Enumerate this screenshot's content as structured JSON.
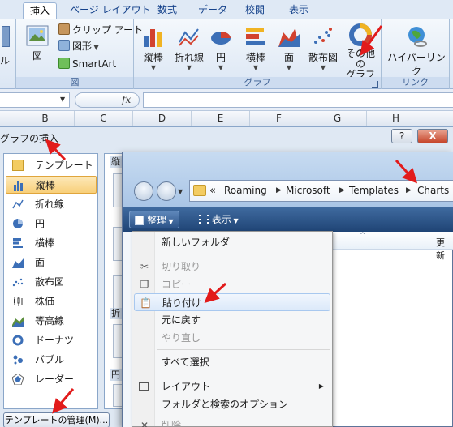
{
  "ribbon": {
    "tabs": [
      "挿入",
      "ページ レイアウト",
      "数式",
      "データ",
      "校閲",
      "表示"
    ],
    "active_tab": "挿入",
    "left_cut_label": "ル",
    "illustrations": {
      "group_label": "図",
      "picture": "図",
      "clip_art": "クリップ アート",
      "shapes": "図形",
      "smartart": "SmartArt"
    },
    "charts": {
      "group_label": "グラフ",
      "buttons": [
        "縦棒",
        "折れ線",
        "円",
        "横棒",
        "面",
        "散布図"
      ],
      "other_charts_line1": "その他の",
      "other_charts_line2": "グラフ"
    },
    "links": {
      "group_label": "リンク",
      "hyperlink": "ハイパーリンク"
    }
  },
  "formula_bar": {
    "fx": "fx"
  },
  "columns": [
    "B",
    "C",
    "D",
    "E",
    "F",
    "G",
    "H"
  ],
  "chart_dialog": {
    "title": "グラフの挿入",
    "help_button": "?",
    "close_button": "X",
    "chart_types": [
      "テンプレート",
      "縦棒",
      "折れ線",
      "円",
      "横棒",
      "面",
      "散布図",
      "株価",
      "等高線",
      "ドーナツ",
      "バブル",
      "レーダー"
    ],
    "selected_type": "縦棒",
    "subtype_headers": [
      "縦",
      "折",
      "円"
    ],
    "manage_templates_button": "テンプレートの管理(M)..."
  },
  "explorer": {
    "breadcrumb": [
      "Roaming",
      "Microsoft",
      "Templates",
      "Charts"
    ],
    "breadcrumb_prefix": "«",
    "toolbar": {
      "organize": "整理",
      "views": "表示"
    },
    "column_date": "更新"
  },
  "organize_menu": {
    "items": [
      {
        "label": "新しいフォルダ",
        "enabled": true
      },
      {
        "label": "切り取り",
        "enabled": false
      },
      {
        "label": "コピー",
        "enabled": false
      },
      {
        "label": "貼り付け",
        "enabled": true
      },
      {
        "label": "元に戻す",
        "enabled": true
      },
      {
        "label": "やり直し",
        "enabled": false
      },
      {
        "label": "すべて選択",
        "enabled": true
      },
      {
        "label": "レイアウト",
        "enabled": true
      },
      {
        "label": "フォルダと検索のオプション",
        "enabled": true
      },
      {
        "label": "削除",
        "enabled": false
      }
    ],
    "highlighted": "貼り付け"
  },
  "colors": {
    "annotation_arrow": "#e21b1b",
    "selected_type_bg": "#f8cf79",
    "toolbar_bg": "#1f4475"
  }
}
